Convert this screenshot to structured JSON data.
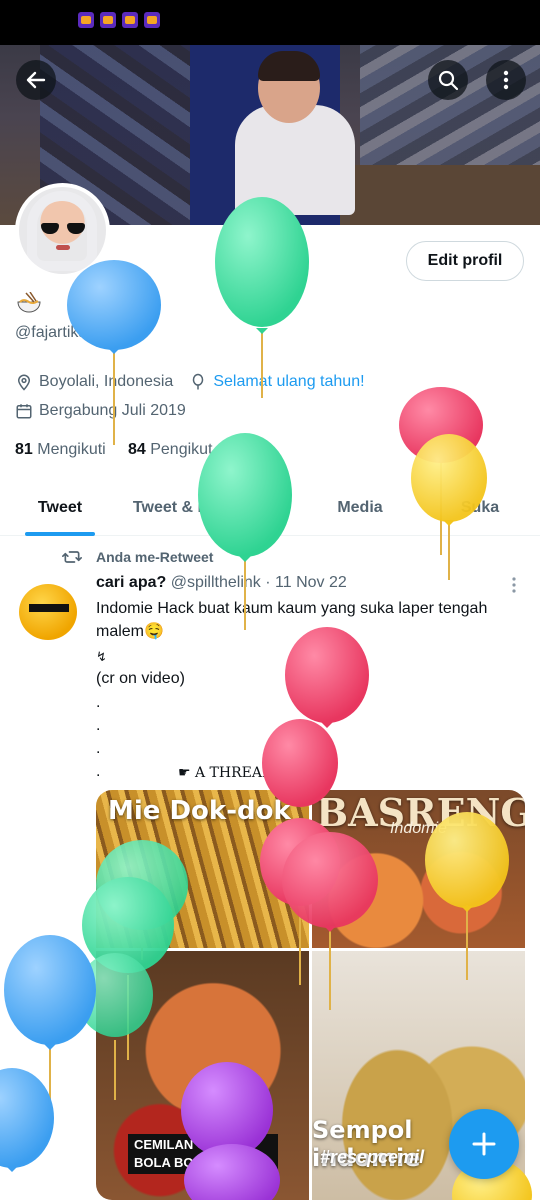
{
  "profile": {
    "handle": "@fajartikaaa",
    "location": "Boyolali, Indonesia",
    "birthday_link": "Selamat ulang tahun!",
    "joined": "Bergabung Juli 2019",
    "following_count": "81",
    "following_label": "Mengikuti",
    "followers_count": "84",
    "followers_label": "Pengikut",
    "edit_label": "Edit profil"
  },
  "tabs": [
    "Tweet",
    "Tweet & balasan",
    "Media",
    "Suka"
  ],
  "retweet_label": "Anda me-Retweet",
  "tweet": {
    "name": "cari apa?",
    "handle": "@spillthelink",
    "date": "· 11 Nov 22",
    "line1": "Indomie Hack buat kaum kaum yang suka laper tengah",
    "line2": "malem🤤",
    "line3": "↯",
    "line4": "(cr on video)",
    "dot": ".",
    "thread": "☛ A THREAD ☚"
  },
  "media": {
    "c1_title": "Mie Dok-dok",
    "c2_title": "BASRENG",
    "c2_sub": "Indomie",
    "c3_caption_1": "CEMILAN    OS",
    "c3_caption_2": "BOLA BOLA       IE",
    "c4_title": "Sempol indomie",
    "c4_sub": "#resepcemil"
  },
  "icons": {
    "back": "arrow-left-icon",
    "search": "search-icon",
    "more": "more-vertical-icon",
    "location": "location-pin-icon",
    "balloon": "balloon-icon",
    "calendar": "calendar-icon",
    "retweet": "retweet-icon",
    "compose": "plus-icon"
  },
  "colors": {
    "accent": "#1d9bf0",
    "text": "#0f1419",
    "muted": "#536471",
    "balloon_blue": "#4aa8f5",
    "balloon_green": "#3ee0a0",
    "balloon_pink": "#f0466e",
    "balloon_yellow": "#f7d21e",
    "balloon_purple": "#a63fe0"
  }
}
